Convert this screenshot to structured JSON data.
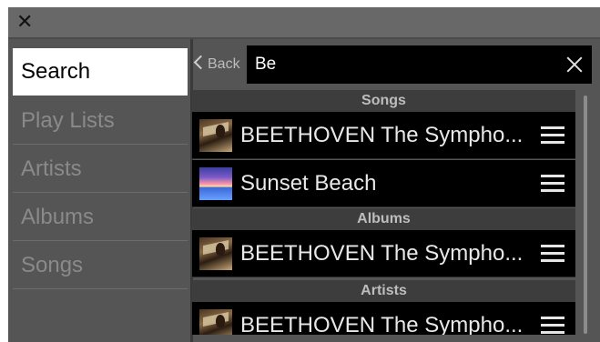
{
  "window": {
    "close_glyph": "✕"
  },
  "sidebar": {
    "items": [
      {
        "label": "Search",
        "active": true
      },
      {
        "label": "Play Lists"
      },
      {
        "label": "Artists"
      },
      {
        "label": "Albums"
      },
      {
        "label": "Songs"
      }
    ]
  },
  "search": {
    "back_label": "Back",
    "value": "Be",
    "placeholder": ""
  },
  "results": {
    "sections": [
      {
        "header": "Songs",
        "rows": [
          {
            "title": "BEETHOVEN  The Sympho...",
            "icon": "beethoven-album-art"
          },
          {
            "title": "Sunset Beach",
            "icon": "sunset-beach-art"
          }
        ]
      },
      {
        "header": "Albums",
        "rows": [
          {
            "title": "BEETHOVEN  The Sympho...",
            "icon": "beethoven-album-art"
          }
        ]
      },
      {
        "header": "Artists",
        "rows": [
          {
            "title": "BEETHOVEN  The Sympho...",
            "icon": "beethoven-album-art"
          }
        ]
      }
    ]
  },
  "colors": {
    "background": "#555555",
    "active_bg": "#ffffff",
    "row_bg": "#000000",
    "section_bg": "#3d3d3d"
  }
}
